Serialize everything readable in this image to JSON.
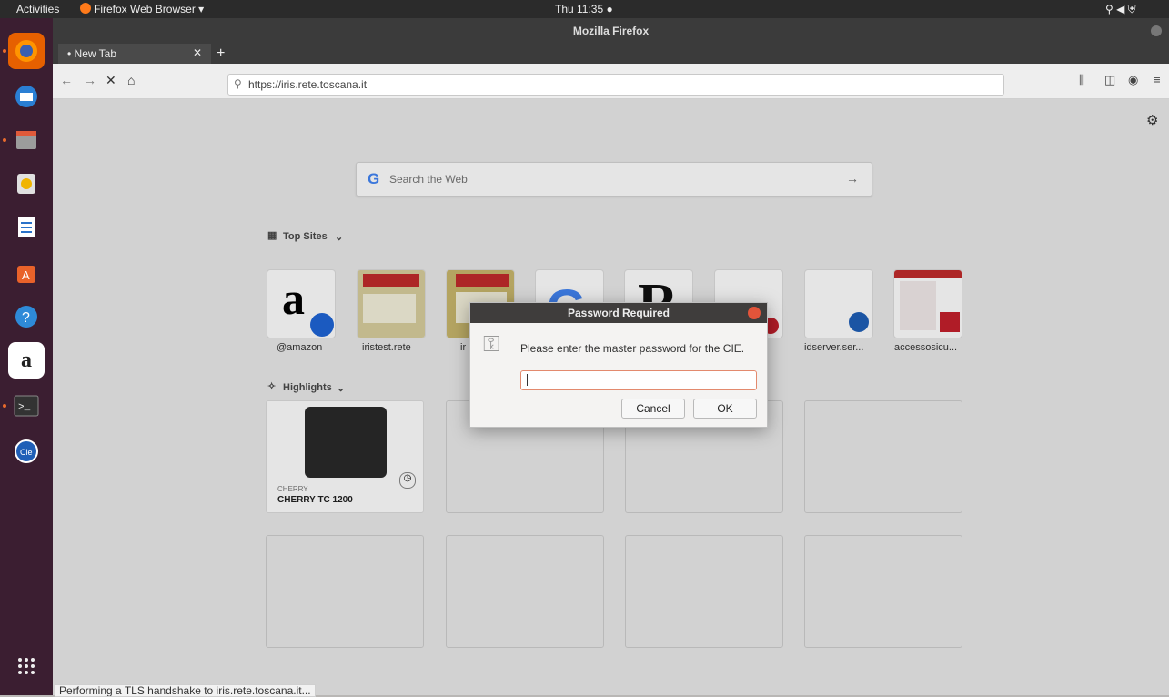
{
  "top_bar": {
    "activities": "Activities",
    "app_menu": "Firefox Web Browser ▾",
    "clock": "Thu 11:35 ●"
  },
  "window": {
    "title": "Mozilla Firefox",
    "tab_label": "• New Tab",
    "new_tab_symbol": "+",
    "url": "https://iris.rete.toscana.it"
  },
  "newtab": {
    "search_placeholder": "Search the Web",
    "top_sites_title": "Top Sites",
    "highlights_title": "Highlights",
    "sites": [
      {
        "label": "@amazon"
      },
      {
        "label": "iristest.rete"
      },
      {
        "label": "ir"
      },
      {
        "label": ""
      },
      {
        "label": ""
      },
      {
        "label": ""
      },
      {
        "label": "idserver.ser..."
      },
      {
        "label": "accessosicu..."
      }
    ],
    "highlight": {
      "source": "CHERRY",
      "title": "CHERRY TC 1200"
    }
  },
  "dialog": {
    "title": "Password Required",
    "message": "Please enter the master password for the CIE.",
    "cancel": "Cancel",
    "ok": "OK"
  },
  "status": "Performing a TLS handshake to iris.rete.toscana.it..."
}
